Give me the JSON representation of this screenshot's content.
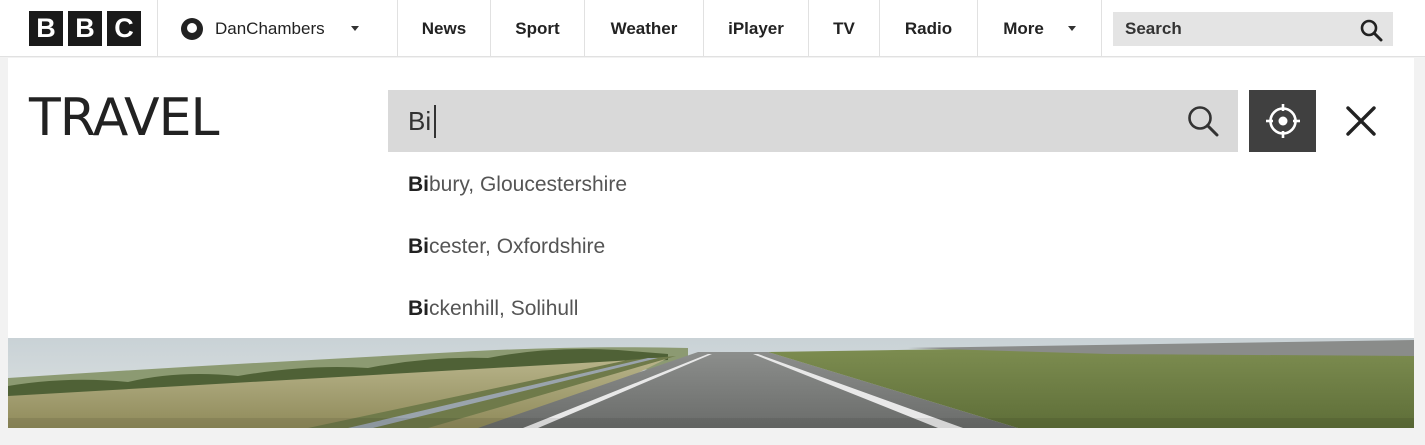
{
  "header": {
    "logo_letters": [
      "B",
      "B",
      "C"
    ],
    "user_name": "DanChambers",
    "nav_items": [
      {
        "label": "News"
      },
      {
        "label": "Sport"
      },
      {
        "label": "Weather"
      },
      {
        "label": "iPlayer"
      },
      {
        "label": "TV"
      },
      {
        "label": "Radio"
      }
    ],
    "more_label": "More",
    "search_placeholder": "Search"
  },
  "travel": {
    "title": "TRAVEL",
    "location_query": "Bi",
    "suggestions": [
      {
        "match": "Bi",
        "rest": "bury, Gloucestershire"
      },
      {
        "match": "Bi",
        "rest": "cester, Oxfordshire"
      },
      {
        "match": "Bi",
        "rest": "ckenhill, Solihull"
      }
    ]
  },
  "colors": {
    "logo_bg": "#1a1a1a",
    "search_bg": "#e4e4e4",
    "input_bg": "#d9d9d9",
    "locate_btn_bg": "#404040"
  },
  "icons": {
    "user": "user-circle-icon",
    "search": "search-icon",
    "locate": "crosshair-icon",
    "close": "close-icon"
  }
}
